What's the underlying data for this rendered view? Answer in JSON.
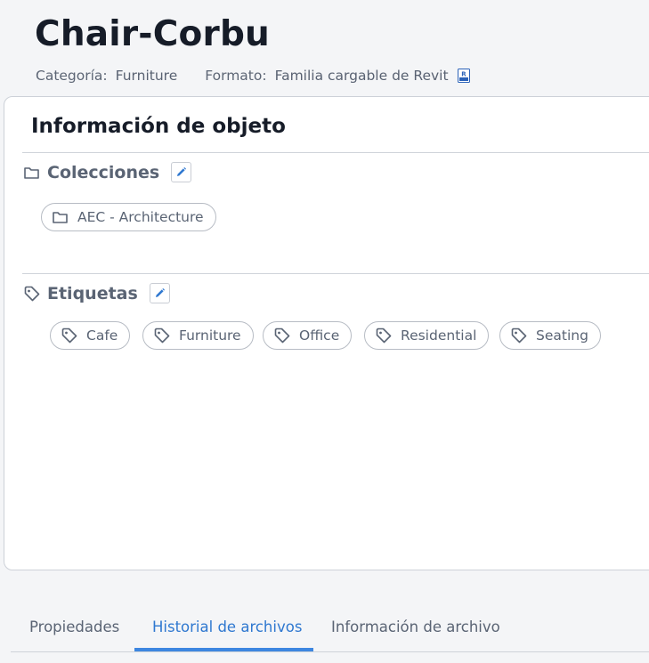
{
  "header": {
    "title": "Chair-Corbu",
    "category_label": "Categoría:",
    "category_value": "Furniture",
    "format_label": "Formato:",
    "format_value": "Familia cargable de Revit",
    "format_icon": "revit-file-icon"
  },
  "object_info": {
    "title": "Información de objeto",
    "collections": {
      "heading": "Colecciones",
      "icon": "folder-icon",
      "edit_icon": "pencil-icon",
      "items": [
        "AEC - Architecture"
      ]
    },
    "tags": {
      "heading": "Etiquetas",
      "icon": "tag-icon",
      "edit_icon": "pencil-icon",
      "items": [
        "Cafe",
        "Furniture",
        "Office",
        "Residential",
        "Seating"
      ]
    }
  },
  "tabs": {
    "items": [
      "Propiedades",
      "Historial de archivos",
      "Información de archivo"
    ],
    "active": "Historial de archivos"
  },
  "colors": {
    "accent": "#3d86e0",
    "text_dark": "#161c28",
    "text_muted": "#5a6474",
    "border": "#cdd1d8"
  }
}
